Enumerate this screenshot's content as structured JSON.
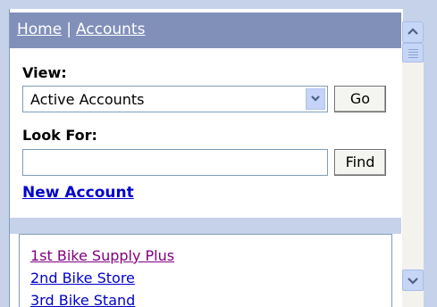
{
  "breadcrumb": {
    "home": "Home",
    "separator": "|",
    "accounts": "Accounts"
  },
  "view": {
    "label": "View:",
    "selected": "Active Accounts",
    "go_label": "Go"
  },
  "look_for": {
    "label": "Look For:",
    "value": "",
    "find_label": "Find"
  },
  "new_account_label": "New Account",
  "accounts": [
    "1st Bike Supply Plus",
    "2nd Bike Store",
    "3rd Bike Stand"
  ],
  "colors": {
    "header": "#8190b9",
    "link": "#0000cc",
    "visited": "#800080",
    "panel_bg": "#c6d2ea"
  }
}
